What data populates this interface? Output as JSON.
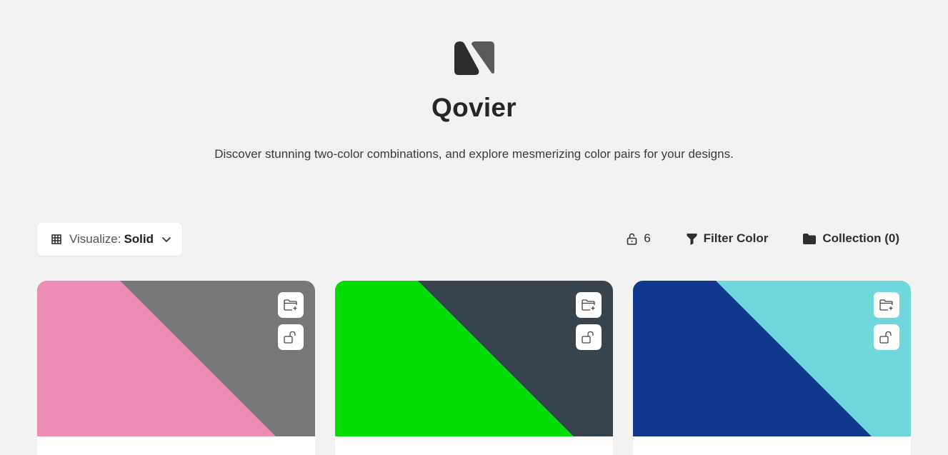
{
  "app": {
    "title": "Qovier",
    "tagline": "Discover stunning two-color combinations, and explore mesmerizing color pairs for your designs."
  },
  "toolbar": {
    "visualize_label": "Visualize:",
    "visualize_value": "Solid",
    "locked_count": "6",
    "filter_label": "Filter Color",
    "collection_label": "Collection (0)"
  },
  "icons": {
    "logo": "qovier-logo",
    "visualize": "grid-icon",
    "dropdown": "chevron-down-icon",
    "locked": "lock-icon",
    "filter": "filter-icon",
    "collection": "folder-icon",
    "card_add": "folder-plus-icon",
    "card_lock": "unlock-icon"
  },
  "cards": [
    {
      "color_a": "#ED8DB6",
      "color_b": "#777777"
    },
    {
      "color_a": "#05DB05",
      "color_b": "#37444D"
    },
    {
      "color_a": "#10398D",
      "color_b": "#70D8DD"
    }
  ]
}
